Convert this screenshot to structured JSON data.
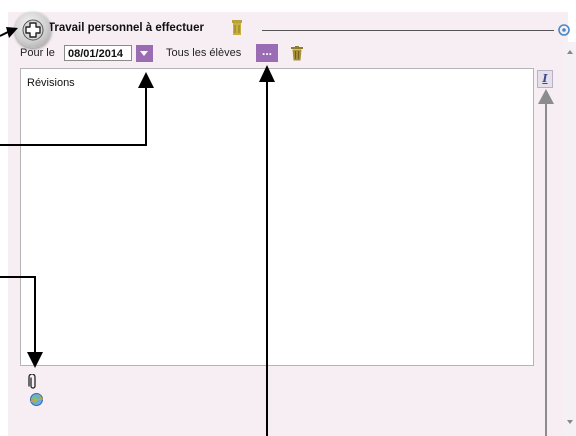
{
  "header": {
    "title": "Travail personnel à effectuer"
  },
  "form": {
    "pour_label": "Pour le",
    "date_value": "08/01/2014",
    "eleves_label": "Tous les élèves",
    "ellipsis_label": "..."
  },
  "editor": {
    "content": "Révisions",
    "italic_label": "I"
  },
  "icons": {
    "add": "plus-circle-icon",
    "bin": "bin-icon",
    "dropdown": "chevron-down-icon",
    "trash": "trash-icon",
    "italic": "italic-icon",
    "attachment": "paperclip-icon",
    "link": "globe-icon",
    "corner": "zoom-icon"
  },
  "colors": {
    "panel_bg": "#f7eef3",
    "accent_purple": "#9a6cb4",
    "bin_gold": "#b8a33a",
    "trash_olive": "#8f7d2e",
    "annotation_black": "#000000",
    "annotation_gray": "#8c8c8c"
  }
}
